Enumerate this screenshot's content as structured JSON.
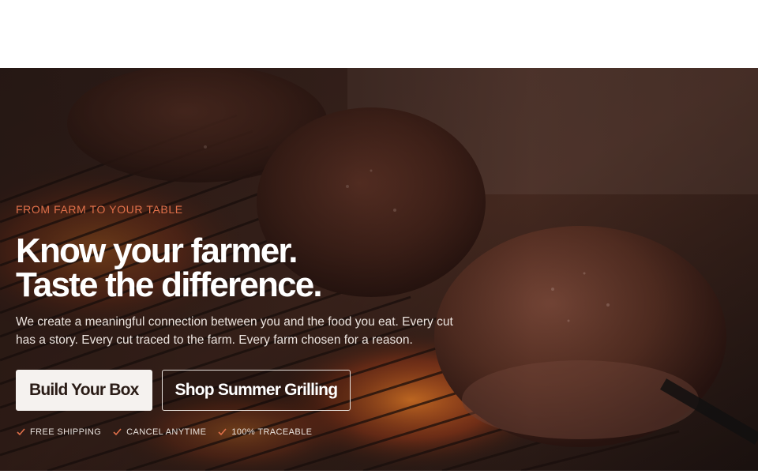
{
  "hero": {
    "eyebrow": "FROM FARM TO YOUR TABLE",
    "headline_line1": "Know your farmer.",
    "headline_line2": "Taste the difference.",
    "subcopy": "We create a meaningful connection between you and the food you eat. Every cut has a story. Every cut traced to the farm. Every farm chosen for a reason.",
    "primary_cta": "Build Your Box",
    "secondary_cta": "Shop Summer Grilling",
    "features": [
      {
        "label": "FREE SHIPPING",
        "icon": "check-icon"
      },
      {
        "label": "CANCEL ANYTIME",
        "icon": "check-icon"
      },
      {
        "label": "100% TRACEABLE",
        "icon": "check-icon"
      }
    ]
  },
  "colors": {
    "accent": "#e0704a",
    "background": "#2a1812",
    "primary_button_bg": "#f5f2ef",
    "text_light": "#ffffff"
  }
}
